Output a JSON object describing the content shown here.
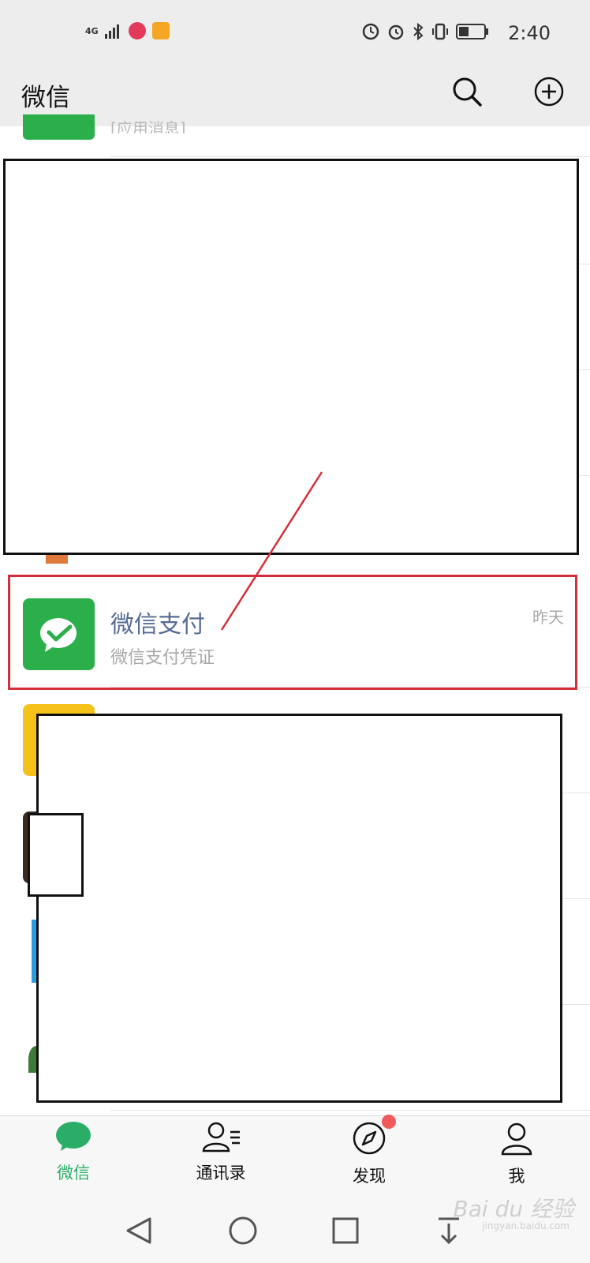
{
  "status_bar": {
    "time": "2:40",
    "network": "4G"
  },
  "header": {
    "title": "微信"
  },
  "chat_list": {
    "partial_item_text": "[应用消息]",
    "highlighted_item": {
      "name": "微信支付",
      "preview": "微信支付凭证",
      "time": "昨天"
    }
  },
  "tabs": [
    {
      "label": "微信",
      "active": true
    },
    {
      "label": "通讯录",
      "active": false
    },
    {
      "label": "发现",
      "active": false,
      "badge": true
    },
    {
      "label": "我",
      "active": false
    }
  ],
  "colors": {
    "accent_green": "#2aae67",
    "wechat_pay_green": "#2aaf4a",
    "highlight_red": "#d32f3a",
    "name_blue": "#576b95"
  },
  "watermark": {
    "text": "Bai du 经验",
    "sub": "jingyan.baidu.com"
  }
}
